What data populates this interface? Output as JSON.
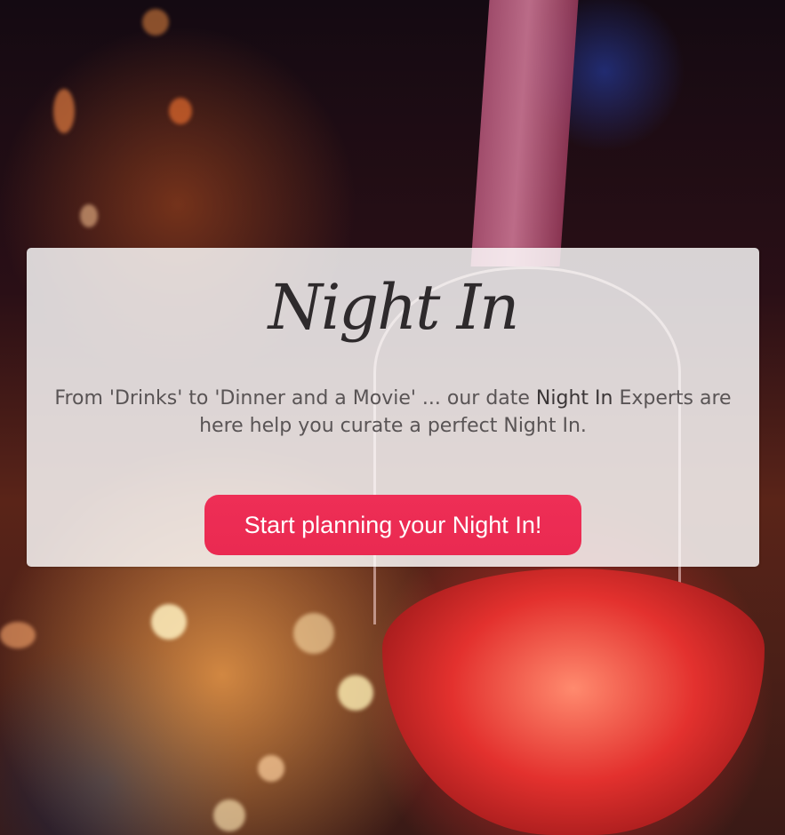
{
  "hero": {
    "title": "Night In",
    "tagline_before": "From 'Drinks' to 'Dinner and a Movie' ... our date ",
    "tagline_highlight": "Night In",
    "tagline_after": " Experts are here help you curate a perfect Night In.",
    "cta_label": "Start planning your Night In!"
  },
  "colors": {
    "cta_background": "#ea2a51",
    "cta_text": "#ffffff",
    "card_background": "rgba(255,255,255,0.82)",
    "title_text": "#2e2a2c",
    "tagline_text": "#595455"
  },
  "background_image": {
    "icon": "wine-glass-bokeh-photo"
  }
}
